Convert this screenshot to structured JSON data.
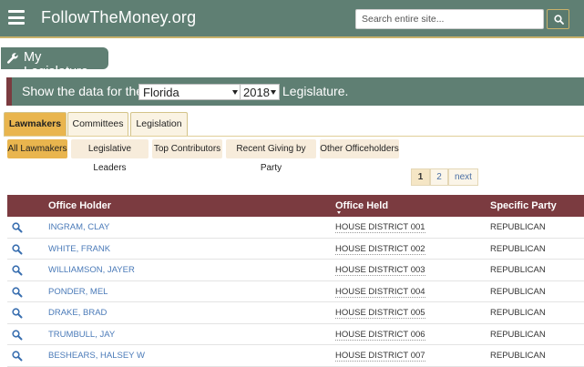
{
  "header": {
    "site_title": "FollowTheMoney.org",
    "search_placeholder": "Search entire site...",
    "menu_icon": "hamburger-menu-icon",
    "search_icon": "search-icon"
  },
  "section": {
    "title": "My Legislature",
    "icon": "wrench-icon"
  },
  "filter": {
    "prefix": "Show the data for the",
    "state": "Florida",
    "year": "2018",
    "suffix": "Legislature."
  },
  "tabs": [
    {
      "label": "Lawmakers",
      "active": true
    },
    {
      "label": "Committees",
      "active": false
    },
    {
      "label": "Legislation",
      "active": false
    }
  ],
  "subtabs": [
    {
      "label": "All Lawmakers",
      "active": true
    },
    {
      "label": "Legislative Leaders",
      "active": false
    },
    {
      "label": "Top Contributors",
      "active": false
    },
    {
      "label": "Recent Giving by Party",
      "active": false
    },
    {
      "label": "Other Officeholders",
      "active": false
    }
  ],
  "pagination": {
    "pages": [
      "1",
      "2"
    ],
    "current": "1",
    "next_label": "next"
  },
  "table": {
    "columns": [
      "Office Holder",
      "Office Held",
      "Specific Party"
    ],
    "rows": [
      {
        "holder": "INGRAM, CLAY",
        "office": "HOUSE DISTRICT 001",
        "party": "REPUBLICAN"
      },
      {
        "holder": "WHITE, FRANK",
        "office": "HOUSE DISTRICT 002",
        "party": "REPUBLICAN"
      },
      {
        "holder": "WILLIAMSON, JAYER",
        "office": "HOUSE DISTRICT 003",
        "party": "REPUBLICAN"
      },
      {
        "holder": "PONDER, MEL",
        "office": "HOUSE DISTRICT 004",
        "party": "REPUBLICAN"
      },
      {
        "holder": "DRAKE, BRAD",
        "office": "HOUSE DISTRICT 005",
        "party": "REPUBLICAN"
      },
      {
        "holder": "TRUMBULL, JAY",
        "office": "HOUSE DISTRICT 006",
        "party": "REPUBLICAN"
      },
      {
        "holder": "BESHEARS, HALSEY W",
        "office": "HOUSE DISTRICT 007",
        "party": "REPUBLICAN"
      }
    ]
  },
  "colors": {
    "header_bg": "#5f7f73",
    "accent_gold": "#e9b54e",
    "table_head_bg": "#7b3b40",
    "link": "#4a7ab8"
  }
}
